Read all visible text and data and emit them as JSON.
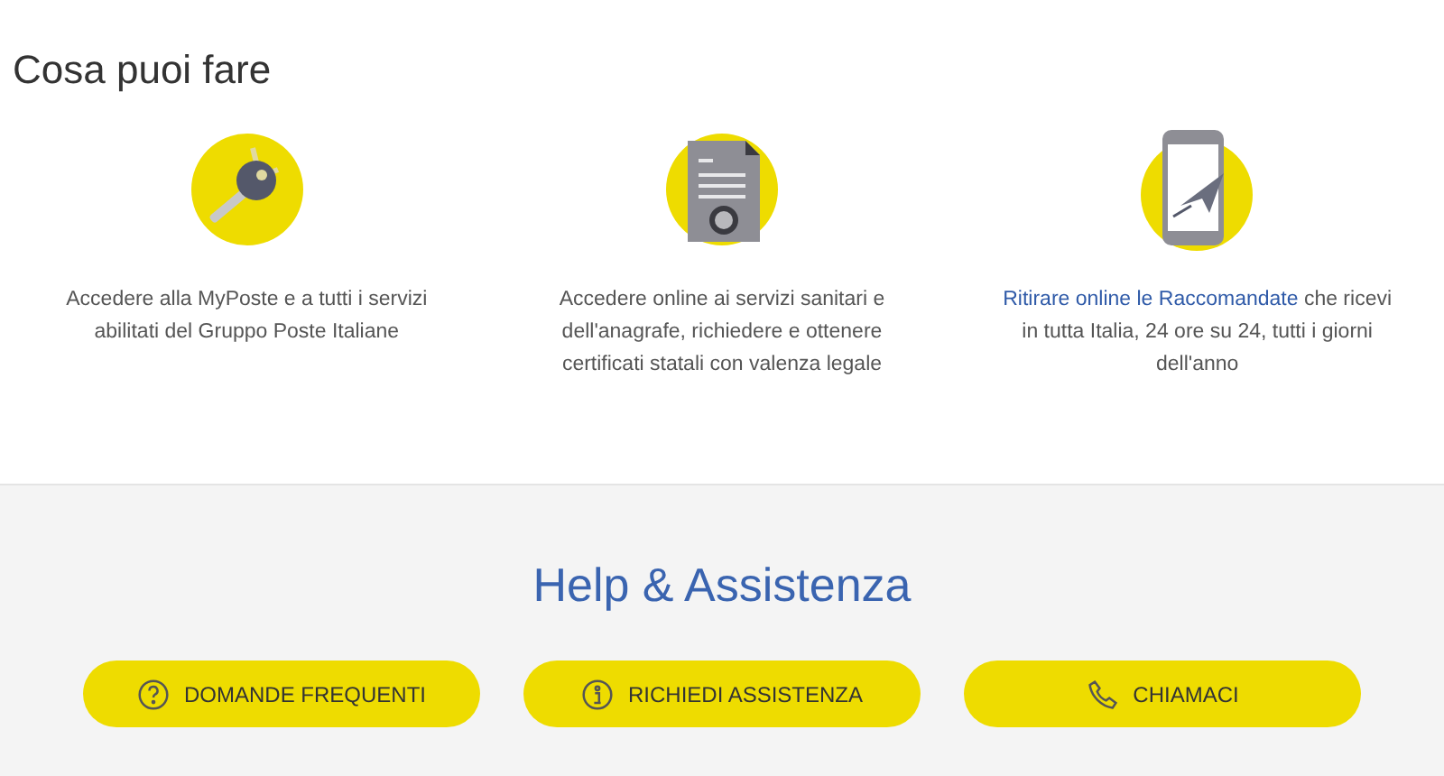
{
  "section_title": "Cosa puoi fare",
  "features": [
    {
      "kind": "key",
      "text": "Accedere alla MyPoste e a tutti i servizi abilitati del Gruppo Poste Italiane"
    },
    {
      "kind": "certificate",
      "text": "Accedere online ai servizi sanitari e dell'anagrafe, richiedere e ottenere certificati statali con valenza legale"
    },
    {
      "kind": "phone",
      "link": "Ritirare online le Raccomandate",
      "text": " che ricevi in tutta Italia, 24 ore su 24, tutti i giorni dell'anno"
    }
  ],
  "help": {
    "title": "Help & Assistenza",
    "buttons": [
      {
        "kind": "question",
        "label": "DOMANDE FREQUENTI"
      },
      {
        "kind": "info",
        "label": "RICHIEDI ASSISTENZA"
      },
      {
        "kind": "phone",
        "label": "CHIAMACI"
      }
    ]
  }
}
